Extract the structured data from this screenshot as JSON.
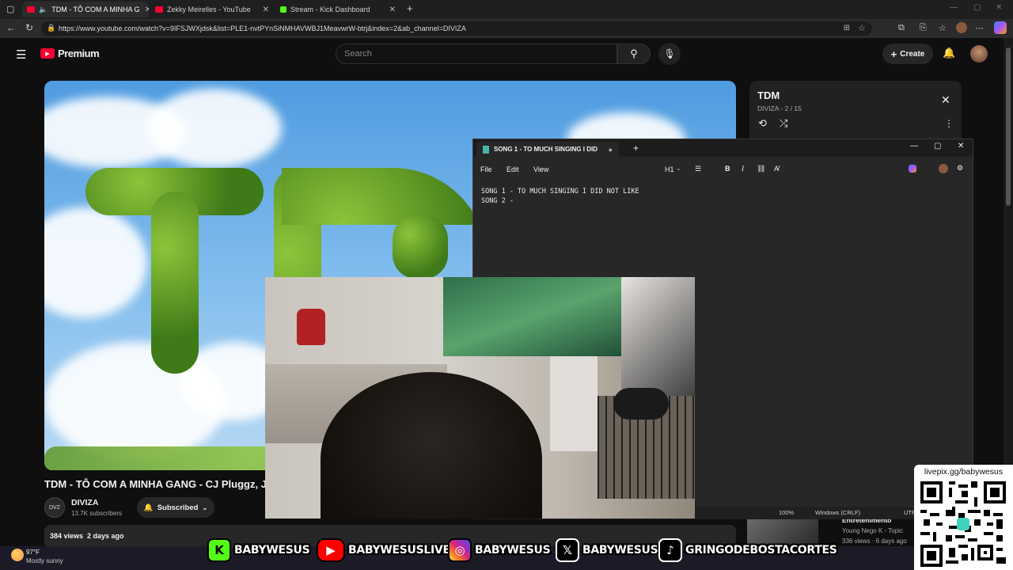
{
  "browser": {
    "tabs": [
      {
        "label": "TDM - TÔ COM A MINHA G",
        "favicon": "youtube-icon",
        "color": "#ff0033"
      },
      {
        "label": "Zekky Meirelles - YouTube",
        "favicon": "youtube-icon",
        "color": "#ff0033"
      },
      {
        "label": "Stream - Kick Dashboard",
        "favicon": "kick-icon",
        "color": "#53fc18"
      }
    ],
    "new_tab": "+",
    "url": "https://www.youtube.com/watch?v=9IFSJWXjdsk&list=PLE1-nvtPYnSiNMHAVWBJ1MeavwrW-btrj&index=2&ab_channel=DIVIZA"
  },
  "youtube": {
    "logo_text": "Premium",
    "search_placeholder": "Search",
    "create_label": "Create",
    "video": {
      "title": "TDM - TÔ COM A MINHA GANG - CJ Pluggz, Jx",
      "channel": "DIVIZA",
      "subscribers": "13.7K subscribers",
      "subscribed_label": "Subscribed",
      "views": "384 views",
      "date": "2 days ago",
      "cover_text": "TD"
    },
    "playlist": {
      "title": "TDM",
      "meta": "DIVIZA - 2 / 15"
    },
    "side_item": {
      "title": "Entretenimento",
      "channel": "Young Nego K - Topic",
      "meta": "336 views · 6 days ago"
    }
  },
  "notepad": {
    "tab_title": "SONG 1 - TO MUCH SINGING I DID",
    "menu": [
      "File",
      "Edit",
      "View"
    ],
    "heading_select": "H1",
    "lines": [
      "SONG 1 - TO MUCH SINGING I DID NOT LIKE",
      "SONG 2 -"
    ],
    "status": {
      "zoom": "100%",
      "line_ending": "Windows (CRLF)",
      "encoding": "UTF"
    }
  },
  "taskbar": {
    "temperature": "97°F",
    "condition": "Mostly sunny"
  },
  "social": [
    {
      "platform": "kick",
      "handle": "BABYWESUS",
      "color": "#53fc18"
    },
    {
      "platform": "youtube",
      "handle": "BABYWESUSLIVE",
      "color": "#ff0000"
    },
    {
      "platform": "instagram",
      "handle": "BABYWESUS",
      "color": "#d62976"
    },
    {
      "platform": "x",
      "handle": "BABYWESUS",
      "color": "#000000"
    },
    {
      "platform": "tiktok",
      "handle": "GRINGODEBOSTACORTES",
      "color": "#000000"
    }
  ],
  "qr": {
    "label": "livepix.gg/babywesus"
  }
}
